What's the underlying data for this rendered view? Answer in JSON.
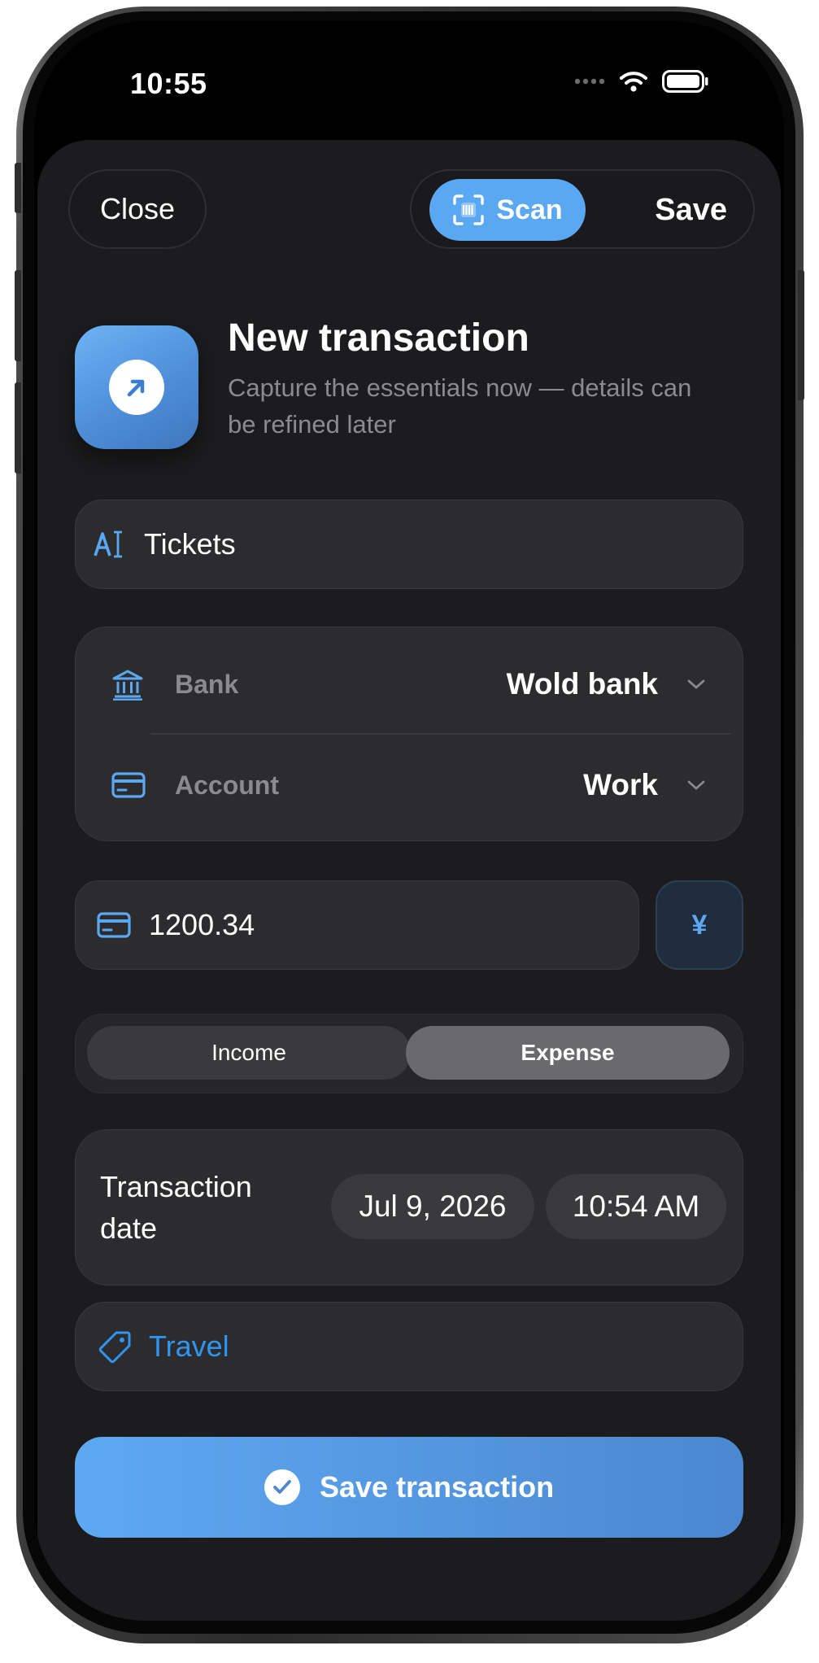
{
  "status_bar": {
    "time": "10:55",
    "icons": [
      "signal-icon",
      "wifi-icon",
      "battery-icon"
    ]
  },
  "toolbar": {
    "close_label": "Close",
    "scan_label": "Scan",
    "save_label": "Save"
  },
  "header": {
    "title": "New transaction",
    "subtitle": "Capture the essentials now — details can be refined later",
    "icon": "arrow-up-right-icon"
  },
  "name_field": {
    "value": "Tickets",
    "icon": "text-cursor-icon"
  },
  "account_card": {
    "bank": {
      "label": "Bank",
      "value": "Wold bank",
      "icon": "bank-icon"
    },
    "account": {
      "label": "Account",
      "value": "Work",
      "icon": "card-icon"
    }
  },
  "amount": {
    "value": "1200.34",
    "icon": "card-icon",
    "currency_symbol": "¥"
  },
  "type_segment": {
    "options": [
      "Income",
      "Expense"
    ],
    "selected": "Expense"
  },
  "transaction_date": {
    "label": "Transaction date",
    "date": "Jul 9, 2026",
    "time": "10:54 AM"
  },
  "category": {
    "value": "Travel",
    "icon": "tag-icon"
  },
  "submit": {
    "label": "Save transaction",
    "icon": "checkmark-circle-icon"
  },
  "colors": {
    "accent": "#5aa7f2",
    "sheet_bg": "#1c1c1e",
    "field_bg": "#2c2c2e",
    "tag_text": "#2f95f0"
  }
}
